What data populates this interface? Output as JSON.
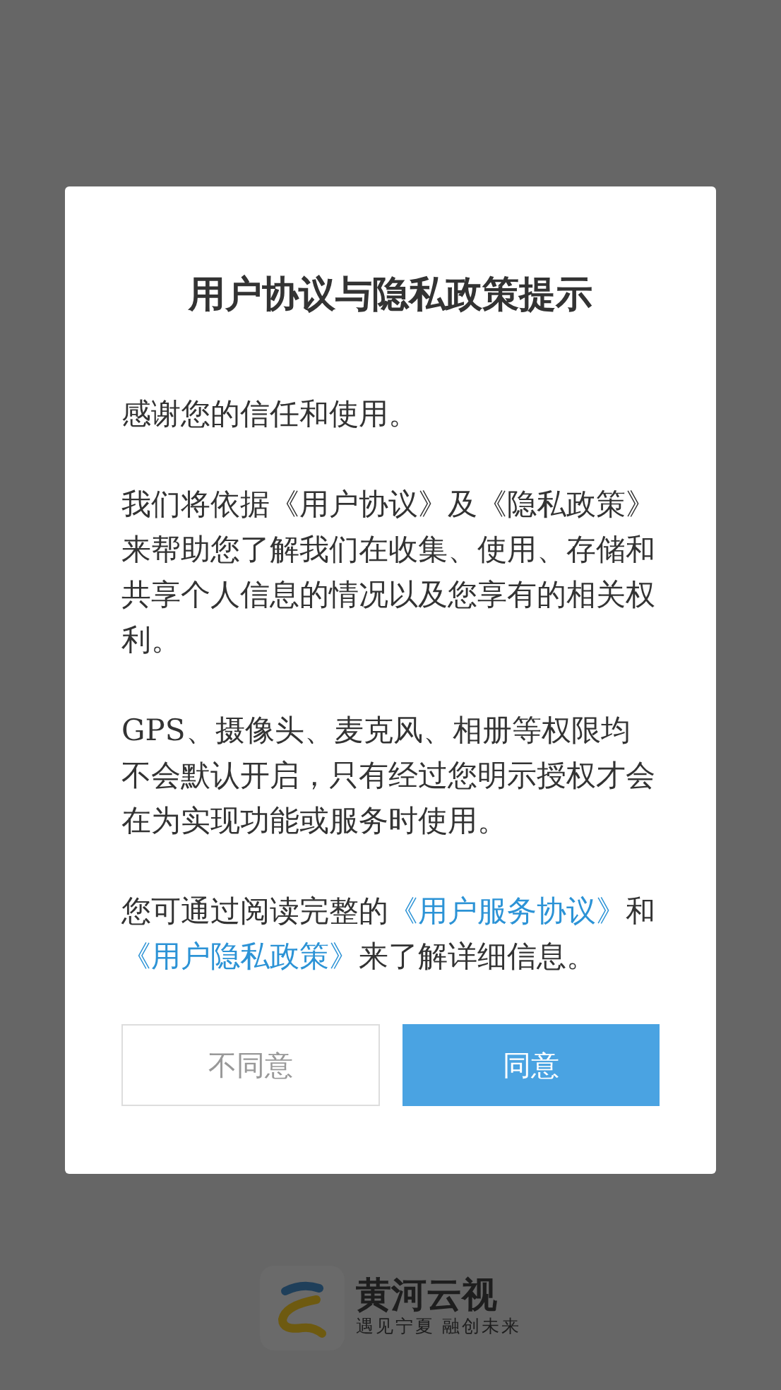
{
  "splash": {
    "app_name": "黄河云视",
    "slogan": "遇见宁夏 融创未来"
  },
  "dialog": {
    "title": "用户协议与隐私政策提示",
    "paragraphs": [
      [
        {
          "kind": "text",
          "text": "感谢您的信任和使用。"
        }
      ],
      [
        {
          "kind": "text",
          "text": "我们将依据《用户协议》及《隐私政策》来帮助您了解我们在收集、使用、存储和共享个人信息的情况以及您享有的相关权利。"
        }
      ],
      [
        {
          "kind": "text",
          "text": "GPS、摄像头、麦克风、相册等权限均不会默认开启，只有经过您明示授权才会在为实现功能或服务时使用。"
        }
      ],
      [
        {
          "kind": "text",
          "text": "您可通过阅读完整的"
        },
        {
          "kind": "link",
          "text": "《用户服务协议》"
        },
        {
          "kind": "text",
          "text": "和"
        },
        {
          "kind": "link",
          "text": "《用户隐私政策》"
        },
        {
          "kind": "text",
          "text": "来了解详细信息。"
        }
      ]
    ],
    "buttons": [
      {
        "label": "不同意",
        "kind": "secondary"
      },
      {
        "label": "同意",
        "kind": "primary"
      }
    ]
  }
}
